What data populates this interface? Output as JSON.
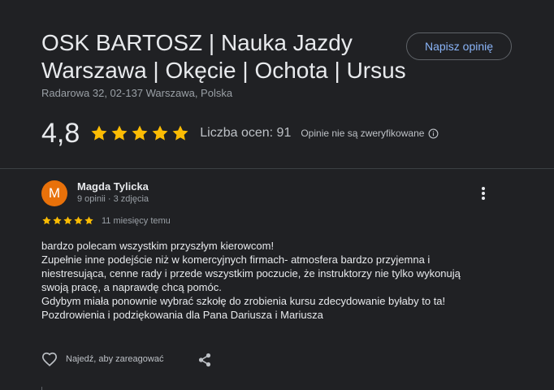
{
  "business": {
    "title_line1": "OSK BARTOSZ | Nauka Jazdy",
    "title_line2": "Warszawa | Okęcie | Ochota | Ursus",
    "address": "Radarowa 32, 02-137 Warszawa, Polska",
    "write_review_label": "Napisz opinię"
  },
  "summary": {
    "rating": "4,8",
    "stars": 5,
    "count_label": "Liczba ocen: 91",
    "unverified_label": "Opinie nie są zweryfikowane",
    "info_icon": "info-icon"
  },
  "review": {
    "avatar_letter": "M",
    "avatar_color": "#e8710a",
    "author": "Magda Tylicka",
    "meta": "9 opinii · 3 zdjęcia",
    "stars": 5,
    "date": "11 miesięcy temu",
    "more_icon": "more-vert-icon",
    "lines": [
      "bardzo polecam wszystkim przyszłym kierowcom!",
      "Zupełnie inne podejście niż w komercyjnych firmach- atmosfera bardzo przyjemna i",
      "niestresująca, cenne rady i przede wszystkim poczucie, że instruktorzy nie tylko wykonują",
      "swoją pracę, a naprawdę chcą pomóc.",
      "Gdybym miała ponownie wybrać szkołę do zrobienia kursu zdecydowanie byłaby to ta!",
      "Pozdrowienia i podziękowania dla Pana Dariusza i Mariusza"
    ],
    "like_label": "Najedź, aby zareagować",
    "like_icon": "heart-icon",
    "share_icon": "share-icon"
  },
  "colors": {
    "background": "#202124",
    "star": "#fbbc04",
    "link": "#8ab4f8",
    "text": "#e8eaed",
    "muted": "#9aa0a6"
  }
}
